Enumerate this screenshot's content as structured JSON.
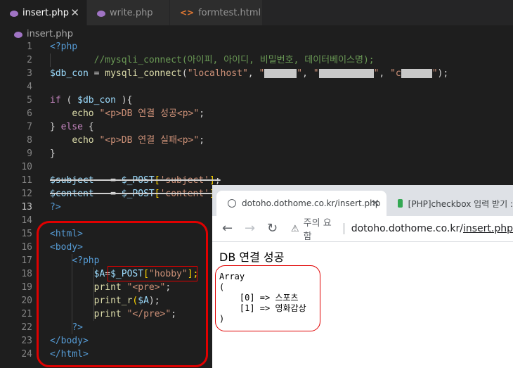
{
  "editor": {
    "tabs": [
      {
        "label": "insert.php",
        "active": true,
        "icon": "php-icon",
        "close": "✕"
      },
      {
        "label": "write.php",
        "active": false,
        "icon": "php-icon"
      },
      {
        "label": "formtest.html",
        "active": false,
        "icon": "html-icon"
      }
    ],
    "breadcrumb": "insert.php",
    "line_numbers": [
      "1",
      "2",
      "3",
      "4",
      "5",
      "6",
      "7",
      "8",
      "9",
      "10",
      "11",
      "12",
      "13",
      "14",
      "15",
      "16",
      "17",
      "18",
      "19",
      "20",
      "21",
      "22",
      "23",
      "24"
    ],
    "current_line": "13",
    "code": {
      "l1": "<?php",
      "l2": "//mysqli_connect(아이피, 아이디, 비밀번호, 데이터베이스명);",
      "l3_var": "$db_con",
      "l3_eq": " = ",
      "l3_fn": "mysqli_connect",
      "l3_open": "(",
      "l3_host": "\"localhost\"",
      "l3_c1": ", ",
      "l3_q1a": "\"",
      "l3_q1b": "\"",
      "l3_c2": ", ",
      "l3_q2a": "\"",
      "l3_q2b": "\"",
      "l3_c3": ", ",
      "l3_q3a": "\"c",
      "l3_q3b": "\"",
      "l3_close": ");",
      "l5_if": "if",
      "l5_open": " ( ",
      "l5_var": "$db_con",
      "l5_close": " ){",
      "l6_echo": "echo",
      "l6_str": "\"<p>DB 연결 성공<p>\"",
      "l6_end": ";",
      "l7_a": "} ",
      "l7_else": "else",
      "l7_b": " {",
      "l8_echo": "echo",
      "l8_str": "\"<p>DB 연결 실패<p>\"",
      "l8_end": ";",
      "l9": "}",
      "l11_var": "$subject",
      "l11_eq": "   = ",
      "l11_post": "$_POST",
      "l11_key": "'subject'",
      "l12_var": "$content",
      "l12_eq": "   = ",
      "l12_post": "$_POST",
      "l12_key": "'content'",
      "l13": "?>",
      "l15": "<html>",
      "l16": "<body>",
      "l17": "<?php",
      "l18_var": "$A",
      "l18_eq": "=",
      "l18_post": "$_POST",
      "l18_key": "\"hobby\"",
      "l18_end": "];",
      "l19_print": "print",
      "l19_str": "\"<pre>\"",
      "l19_end": ";",
      "l20_fn": "print_r",
      "l20_var": "$A",
      "l20_end": ");",
      "l21_print": "print",
      "l21_str": "\"</pre>\"",
      "l21_end": ";",
      "l22": "?>",
      "l23": "</body>",
      "l24": "</html>"
    }
  },
  "browser": {
    "tabs": [
      {
        "label": "dotoho.dothome.co.kr/insert.php",
        "active": true,
        "icon": "globe-icon",
        "close": "✕"
      },
      {
        "label": "[PHP]checkbox 입력 받기 : ",
        "active": false,
        "icon": "chat-icon"
      }
    ],
    "toolbar": {
      "back": "←",
      "forward": "→",
      "reload": "↻",
      "warning": "주의 요함",
      "url_host": "dotoho.dothome.co.kr/",
      "url_path": "insert.php"
    },
    "page": {
      "message": "DB 연결 성공",
      "output": "Array\n(\n    [0] => 스포츠\n    [1] => 영화감상\n)"
    }
  },
  "colors": {
    "annotation": "#e00000",
    "php_icon": "#a074c4"
  }
}
